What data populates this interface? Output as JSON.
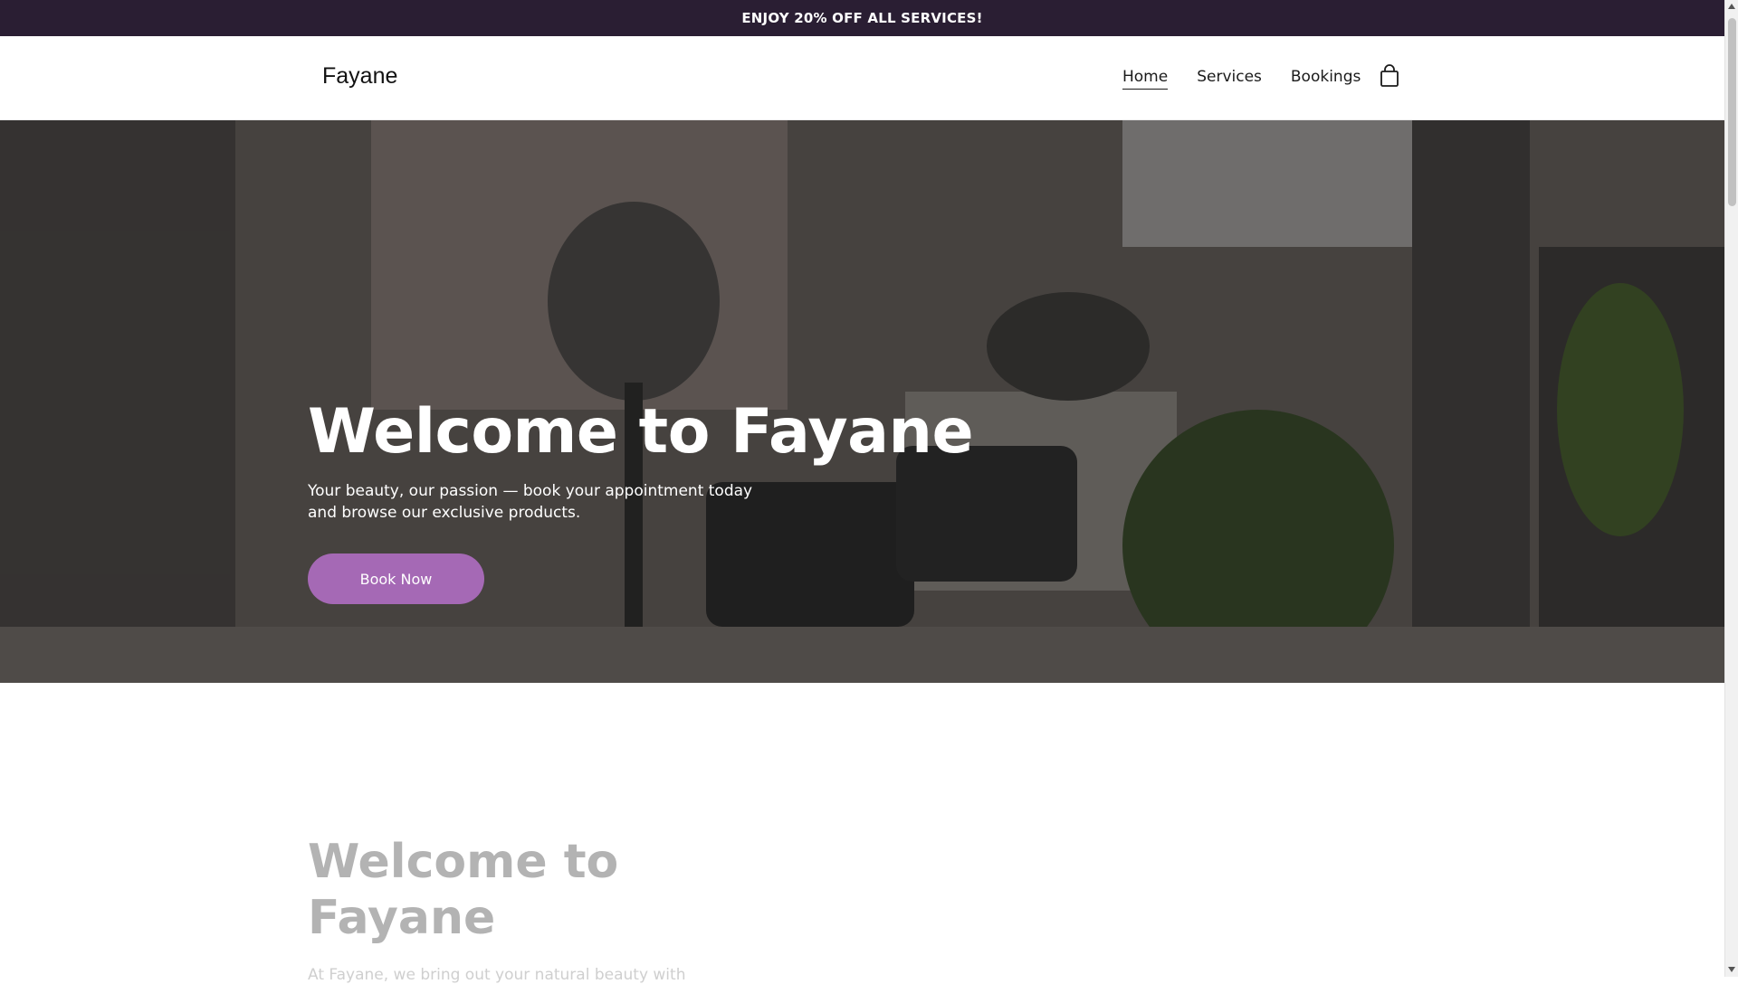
{
  "announcement": "ENJOY 20% OFF ALL SERVICES!",
  "header": {
    "logo": "Fayane",
    "nav": [
      "Home",
      "Services",
      "Bookings"
    ],
    "active_nav": "Home",
    "cart_icon": "shopping-bag-icon"
  },
  "hero": {
    "title": "Welcome to Fayane",
    "subtitle": "Your beauty, our passion — book your appointment today and browse our exclusive products.",
    "button_label": "Book Now",
    "background": "photo of hair salon interior"
  },
  "welcome_section": {
    "title": "Welcome to Fayane",
    "text": "At Fayane, we bring out your natural beauty with"
  },
  "colors": {
    "announcement_bg": "#2a1e33",
    "button": "#a569b5",
    "section_title": "#b3b3b3"
  }
}
